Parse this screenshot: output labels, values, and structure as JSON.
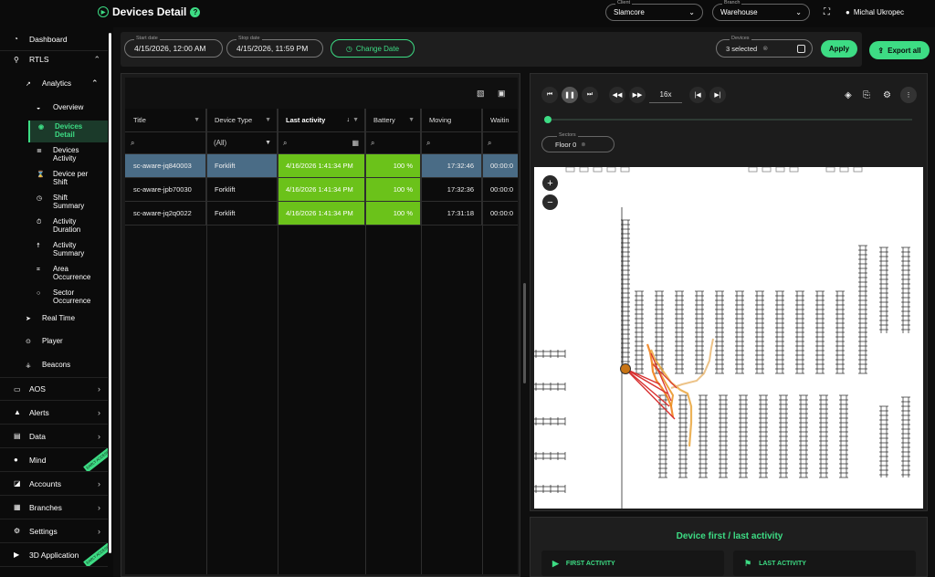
{
  "header": {
    "title": "Devices Detail",
    "client_label": "Client",
    "client_value": "Slamcore",
    "branch_label": "Branch",
    "branch_value": "Warehouse",
    "user_name": "Michal Ukropec"
  },
  "sidebar": {
    "items": [
      {
        "label": "Dashboard",
        "icon": "dashboard-icon"
      },
      {
        "label": "RTLS",
        "icon": "location-pin-icon"
      },
      {
        "label": "AOS",
        "icon": "tray-icon"
      },
      {
        "label": "Alerts",
        "icon": "warning-icon"
      },
      {
        "label": "Data",
        "icon": "database-icon"
      },
      {
        "label": "Mind",
        "icon": "brain-icon",
        "ribbon": "EARLY ACCESS"
      },
      {
        "label": "Accounts",
        "icon": "accounts-icon"
      },
      {
        "label": "Branches",
        "icon": "branches-icon"
      },
      {
        "label": "Settings",
        "icon": "gear-icon"
      },
      {
        "label": "3D Application",
        "icon": "play-icon",
        "ribbon": "EARLY ACCESS"
      }
    ],
    "analytics_label": "Analytics",
    "sub_items": [
      "Overview",
      "Devices Detail",
      "Devices Activity",
      "Device per Shift",
      "Shift Summary",
      "Activity Duration",
      "Activity Summary",
      "Area Occurrence",
      "Sector Occurrence"
    ],
    "rtls_items": [
      "Real Time",
      "Player",
      "Beacons"
    ]
  },
  "filters": {
    "start_date_label": "Start date",
    "start_date": "4/15/2026, 12:00 AM",
    "stop_date_label": "Stop date",
    "stop_date": "4/15/2026, 11:59 PM",
    "change_date": "Change Date",
    "devices_label": "Devices",
    "devices_value": "3 selected",
    "apply": "Apply",
    "export_all": "Export all"
  },
  "grid": {
    "columns": [
      "Title",
      "Device Type",
      "Last activity",
      "Battery",
      "Moving",
      "Waitin"
    ],
    "device_type_filter": "(All)",
    "rows": [
      {
        "title": "sc-aware-jq840003",
        "type": "Forklift",
        "last": "4/16/2026 1:41:34 PM",
        "battery": "100 %",
        "moving": "17:32:46",
        "waiting": "00:00:0"
      },
      {
        "title": "sc-aware-jpb70030",
        "type": "Forklift",
        "last": "4/16/2026 1:41:34 PM",
        "battery": "100 %",
        "moving": "17:32:36",
        "waiting": "00:00:0"
      },
      {
        "title": "sc-aware-jq2q0022",
        "type": "Forklift",
        "last": "4/16/2026 1:41:34 PM",
        "battery": "100 %",
        "moving": "17:31:18",
        "waiting": "00:00:0"
      }
    ]
  },
  "player": {
    "speed": "16x",
    "sectors_label": "Sectors",
    "sectors_value": "Floor 0"
  },
  "activity": {
    "title": "Device first / last activity",
    "first": "FIRST ACTIVITY",
    "last": "LAST ACTIVITY"
  },
  "colors": {
    "accent": "#3ddc84",
    "battery_ok": "#6bc21a",
    "selected_row": "#4a6c86"
  }
}
